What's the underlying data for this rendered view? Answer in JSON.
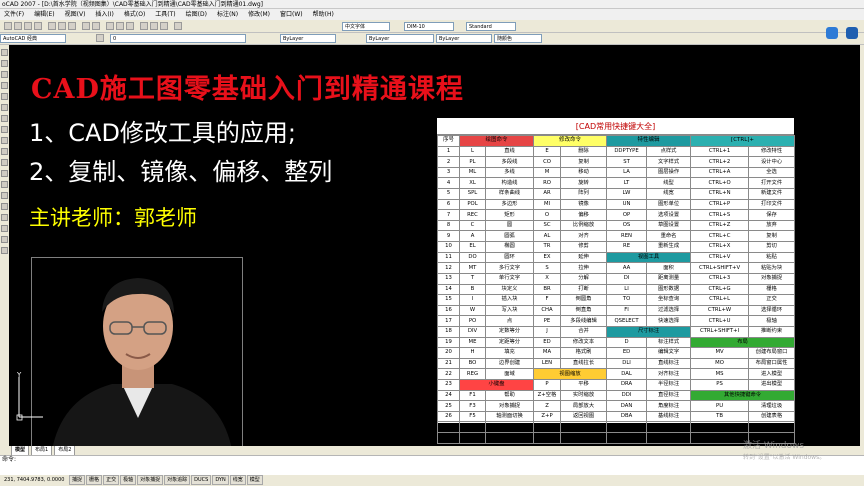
{
  "window": {
    "title": "oCAD 2007 - [D:\\首水学院（视频图集）\\CAD零基础入门到精通\\CAD零基础入门到精通01.dwg]"
  },
  "menu": [
    "文件(F)",
    "编辑(E)",
    "视图(V)",
    "插入(I)",
    "格式(O)",
    "工具(T)",
    "绘图(D)",
    "标注(N)",
    "修改(M)",
    "窗口(W)",
    "帮助(H)"
  ],
  "toolbar": {
    "text_style": "中文字体",
    "dim_style": "DIM-10",
    "table_style": "Standard",
    "workspace": "AutoCAD 经典",
    "layer": "0",
    "color": "ByLayer",
    "linetype": "ByLayer",
    "lineweight": "ByLayer",
    "plotstyle": "随颜色"
  },
  "slide": {
    "heading": "CAD施工图零基础入门到精通课程",
    "point1": "1、CAD修改工具的应用;",
    "point2": "2、复制、镜像、偏移、整列",
    "teacher": "主讲老师：郭老师"
  },
  "shortcut_table": {
    "title": "[CAD常用快捷键大全]",
    "colors": {
      "draw": "#e64545",
      "modify": "#ffff66",
      "object": "#1e9aa0",
      "ctrl": "#2bb0b0",
      "view": "#1e9aa0",
      "dim": "#1e9aa0",
      "layout": "#33aa33",
      "block": "#ff4444",
      "other": "#ffcc33"
    },
    "header": [
      "序号",
      "绘图命令",
      "",
      "修改命令",
      "",
      "特性编辑",
      "",
      "[CTRL]+",
      ""
    ],
    "rows": [
      [
        "1",
        "L",
        "直线",
        "E",
        "删除",
        "DDPTYPE",
        "点样式",
        "CTRL+1",
        "修改特性"
      ],
      [
        "2",
        "PL",
        "多段线",
        "CO",
        "复制",
        "ST",
        "文字样式",
        "CTRL+2",
        "设计中心"
      ],
      [
        "3",
        "ML",
        "多线",
        "M",
        "移动",
        "LA",
        "图层操作",
        "CTRL+A",
        "全选"
      ],
      [
        "4",
        "XL",
        "构造线",
        "RO",
        "旋转",
        "LT",
        "线型",
        "CTRL+O",
        "打开文件"
      ],
      [
        "5",
        "SPL",
        "样条曲线",
        "AR",
        "阵列",
        "LW",
        "线宽",
        "CTRL+N",
        "新建文件"
      ],
      [
        "6",
        "POL",
        "多边形",
        "MI",
        "镜像",
        "UN",
        "图形单位",
        "CTRL+P",
        "打印文件"
      ],
      [
        "7",
        "REC",
        "矩形",
        "O",
        "偏移",
        "OP",
        "选项设置",
        "CTRL+S",
        "保存"
      ],
      [
        "8",
        "C",
        "圆",
        "SC",
        "比例缩放",
        "OS",
        "草图设置",
        "CTRL+Z",
        "放弃"
      ],
      [
        "9",
        "A",
        "圆弧",
        "AL",
        "对齐",
        "REN",
        "重命名",
        "CTRL+C",
        "复制"
      ],
      [
        "10",
        "EL",
        "椭圆",
        "TR",
        "修剪",
        "RE",
        "重新生成",
        "CTRL+X",
        "剪切"
      ],
      [
        "11",
        "DO",
        "圆环",
        "EX",
        "延伸",
        "视图工具",
        "",
        "CTRL+V",
        "粘贴"
      ],
      [
        "12",
        "MT",
        "多行文字",
        "S",
        "拉伸",
        "AA",
        "面积",
        "CTRL+SHIFT+V",
        "粘贴为块"
      ],
      [
        "13",
        "T",
        "单行文字",
        "X",
        "分解",
        "DI",
        "距离测量",
        "CTRL+3",
        "对象捕捉"
      ],
      [
        "14",
        "B",
        "块定义",
        "BR",
        "打断",
        "LI",
        "图形数据",
        "CTRL+G",
        "栅格"
      ],
      [
        "15",
        "I",
        "插入块",
        "F",
        "倒圆角",
        "TO",
        "坐标查询",
        "CTRL+L",
        "正交"
      ],
      [
        "16",
        "W",
        "写入块",
        "CHA",
        "倒直角",
        "FI",
        "过滤选择",
        "CTRL+W",
        "选择循环"
      ],
      [
        "17",
        "PO",
        "点",
        "PE",
        "多段线编辑",
        "QSELECT",
        "快速选择",
        "CTRL+U",
        "极轴"
      ],
      [
        "18",
        "DIV",
        "定数等分",
        "J",
        "合并",
        "尺寸标注",
        "",
        "CTRL+SHIFT+I",
        "推断约束"
      ],
      [
        "19",
        "ME",
        "定距等分",
        "ED",
        "修改文本",
        "D",
        "标注样式",
        "布局",
        ""
      ],
      [
        "20",
        "H",
        "填充",
        "MA",
        "格式刷",
        "ED",
        "编辑文字",
        "MV",
        "创建布局窗口"
      ],
      [
        "21",
        "BO",
        "边界创建",
        "LEN",
        "直线拉长",
        "DLI",
        "直线标注",
        "MO",
        "布局窗口属性"
      ],
      [
        "22",
        "REG",
        "面域",
        "视图缩放",
        "",
        "DAL",
        "对齐标注",
        "MS",
        "进入模型"
      ],
      [
        "23",
        "小键盘",
        "",
        "P",
        "平移",
        "DRA",
        "半径标注",
        "PS",
        "进出模型"
      ],
      [
        "24",
        "F1",
        "帮助",
        "Z+空格",
        "实时缩放",
        "DDI",
        "直径标注",
        "其他快捷键命令",
        ""
      ],
      [
        "25",
        "F3",
        "对象捕捉",
        "Z",
        "局部放大",
        "DAN",
        "角度标注",
        "PU",
        "清理垃圾"
      ],
      [
        "26",
        "F5",
        "轴测面切换",
        "Z+P",
        "返回视图",
        "DBA",
        "基线标注",
        "TB",
        "创建表格"
      ],
      [
        "27",
        "F8",
        "正交",
        "Z+E",
        "显示全图",
        "LE",
        "引线标注",
        "ATT",
        "定义属性"
      ],
      [
        "28",
        "F12",
        "动态输入",
        "Z+W",
        "显示窗选",
        "TOL",
        "公差标注",
        "ATE",
        "编辑属性"
      ]
    ]
  },
  "tabs": [
    "模型",
    "布局1",
    "布局2"
  ],
  "command": {
    "prompt": "命令:"
  },
  "status": {
    "coords": "231, 7404.9783, 0.0000",
    "toggles": [
      "捕捉",
      "栅格",
      "正交",
      "极轴",
      "对象捕捉",
      "对象追踪",
      "DUCS",
      "DYN",
      "线宽",
      "模型"
    ]
  },
  "watermark": {
    "line1": "激活 Windows",
    "line2": "转到\"设置\"以激活 Windows。"
  }
}
